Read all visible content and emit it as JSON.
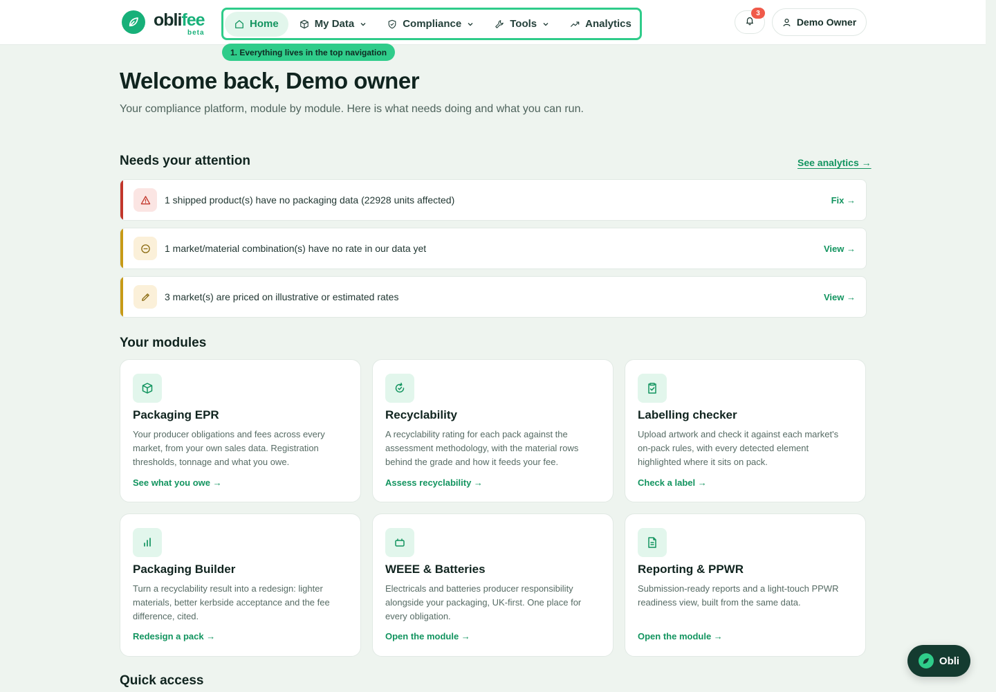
{
  "brand": {
    "name_part1": "obli",
    "name_part2": "fee",
    "tag": "beta",
    "accent": "#17b079"
  },
  "nav": {
    "items": [
      {
        "label": "Home",
        "icon": "home-icon",
        "active": true
      },
      {
        "label": "My Data",
        "icon": "cube-icon",
        "dropdown": true
      },
      {
        "label": "Compliance",
        "icon": "shield-icon",
        "dropdown": true
      },
      {
        "label": "Tools",
        "icon": "wrench-icon",
        "dropdown": true
      },
      {
        "label": "Analytics",
        "icon": "trend-icon"
      }
    ],
    "tip": "1. Everything lives in the top navigation"
  },
  "notifications": {
    "count": "3",
    "icon": "bell-icon"
  },
  "user": {
    "name": "Demo Owner",
    "icon": "user-icon"
  },
  "welcome": {
    "title": "Welcome back, Demo owner",
    "subtitle": "Your compliance platform, module by module. Here is what needs doing and what you can run."
  },
  "attention": {
    "title": "Needs your attention",
    "link": "See analytics →",
    "alerts": [
      {
        "text": "1 shipped product(s) have no packaging data (22928 units affected)",
        "action": "Fix →",
        "icon": "warning-icon",
        "color": "#c2362b"
      },
      {
        "text": "1 market/material combination(s) have no rate in our data yet",
        "action": "View →",
        "icon": "minus-circle-icon",
        "color": "#c79a17"
      },
      {
        "text": "3 market(s) are priced on illustrative or estimated rates",
        "action": "View →",
        "icon": "pencil-icon",
        "color": "#c79a17"
      }
    ]
  },
  "modules": {
    "title": "Your modules",
    "cards": [
      {
        "title": "Packaging EPR",
        "desc": "Your producer obligations and fees across every market, from your own sales data. Registration thresholds, tonnage and what you owe.",
        "link": "See what you owe →",
        "icon": "box-icon"
      },
      {
        "title": "Recyclability",
        "desc": "A recyclability rating for each pack against the assessment methodology, with the material rows behind the grade and how it feeds your fee.",
        "link": "Assess recyclability →",
        "icon": "refresh-icon"
      },
      {
        "title": "Labelling checker",
        "desc": "Upload artwork and check it against each market's on-pack rules, with every detected element highlighted where it sits on pack.",
        "link": "Check a label →",
        "icon": "clipboard-check-icon"
      },
      {
        "title": "Packaging Builder",
        "desc": "Turn a recyclability result into a redesign: lighter materials, better kerbside acceptance and the fee difference, cited.",
        "link": "Redesign a pack →",
        "icon": "bar-chart-icon"
      },
      {
        "title": "WEEE & Batteries",
        "desc": "Electricals and batteries producer responsibility alongside your packaging, UK-first. One place for every obligation.",
        "link": "Open the module →",
        "icon": "battery-icon"
      },
      {
        "title": "Reporting & PPWR",
        "desc": "Submission-ready reports and a light-touch PPWR readiness view, built from the same data.",
        "link": "Open the module →",
        "icon": "document-icon"
      }
    ]
  },
  "quick_access": {
    "title": "Quick access"
  },
  "assistant": {
    "label": "Obli",
    "icon": "leaf-icon"
  }
}
